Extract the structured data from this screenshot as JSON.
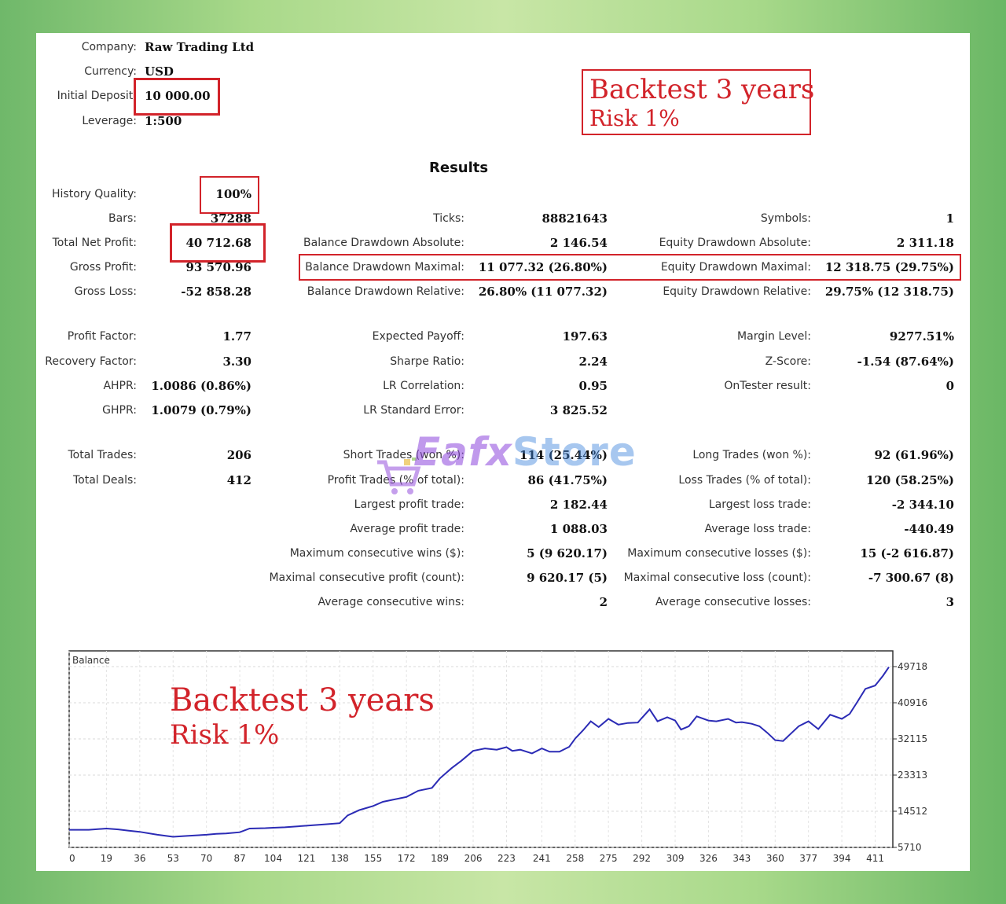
{
  "header": {
    "company_label": "Company:",
    "company_value": "Raw Trading Ltd",
    "currency_label": "Currency:",
    "currency_value": "USD",
    "deposit_label": "Initial Deposit:",
    "deposit_value": "10 000.00",
    "leverage_label": "Leverage:",
    "leverage_value": "1:500"
  },
  "promo_top": {
    "line1": "Backtest 3 years",
    "line2": "Risk 1%"
  },
  "results_title": "Results",
  "col1": [
    {
      "label": "History Quality:",
      "value": "100%"
    },
    {
      "label": "Bars:",
      "value": "37288"
    },
    {
      "label": "Total Net Profit:",
      "value": "40 712.68"
    },
    {
      "label": "Gross Profit:",
      "value": "93 570.96"
    },
    {
      "label": "Gross Loss:",
      "value": "-52 858.28"
    },
    {
      "label": "Profit Factor:",
      "value": "1.77"
    },
    {
      "label": "Recovery Factor:",
      "value": "3.30"
    },
    {
      "label": "AHPR:",
      "value": "1.0086 (0.86%)"
    },
    {
      "label": "GHPR:",
      "value": "1.0079 (0.79%)"
    },
    {
      "label": "Total Trades:",
      "value": "206"
    },
    {
      "label": "Total Deals:",
      "value": "412"
    }
  ],
  "col2": [
    {
      "label": "Ticks:",
      "value": "88821643"
    },
    {
      "label": "Balance Drawdown Absolute:",
      "value": "2 146.54"
    },
    {
      "label": "Balance Drawdown Maximal:",
      "value": "11 077.32 (26.80%)"
    },
    {
      "label": "Balance Drawdown Relative:",
      "value": "26.80% (11 077.32)"
    },
    {
      "label": "Expected Payoff:",
      "value": "197.63"
    },
    {
      "label": "Sharpe Ratio:",
      "value": "2.24"
    },
    {
      "label": "LR Correlation:",
      "value": "0.95"
    },
    {
      "label": "LR Standard Error:",
      "value": "3 825.52"
    },
    {
      "label": "Short Trades (won %):",
      "value": "114 (25.44%)"
    },
    {
      "label": "Profit Trades (% of total):",
      "value": "86 (41.75%)"
    },
    {
      "label": "Largest profit trade:",
      "value": "2 182.44"
    },
    {
      "label": "Average profit trade:",
      "value": "1 088.03"
    },
    {
      "label": "Maximum consecutive wins ($):",
      "value": "5 (9 620.17)"
    },
    {
      "label": "Maximal consecutive profit (count):",
      "value": "9 620.17 (5)"
    },
    {
      "label": "Average consecutive wins:",
      "value": "2"
    }
  ],
  "col3": [
    {
      "label": "Symbols:",
      "value": "1"
    },
    {
      "label": "Equity Drawdown Absolute:",
      "value": "2 311.18"
    },
    {
      "label": "Equity Drawdown Maximal:",
      "value": "12 318.75 (29.75%)"
    },
    {
      "label": "Equity Drawdown Relative:",
      "value": "29.75% (12 318.75)"
    },
    {
      "label": "Margin Level:",
      "value": "9277.51%"
    },
    {
      "label": "Z-Score:",
      "value": "-1.54 (87.64%)"
    },
    {
      "label": "OnTester result:",
      "value": "0"
    },
    {
      "label": "Long Trades (won %):",
      "value": "92 (61.96%)"
    },
    {
      "label": "Loss Trades (% of total):",
      "value": "120 (58.25%)"
    },
    {
      "label": "Largest loss trade:",
      "value": "-2 344.10"
    },
    {
      "label": "Average loss trade:",
      "value": "-440.49"
    },
    {
      "label": "Maximum consecutive losses ($):",
      "value": "15 (-2 616.87)"
    },
    {
      "label": "Maximal consecutive loss (count):",
      "value": "-7 300.67 (8)"
    },
    {
      "label": "Average consecutive losses:",
      "value": "3"
    }
  ],
  "watermark": {
    "part1": "Eafx",
    "part2": "Store"
  },
  "chart_data": {
    "type": "line",
    "title": "Balance",
    "promo_line1": "Backtest 3 years",
    "promo_line2": "Risk 1%",
    "x_ticks": [
      0,
      19,
      36,
      53,
      70,
      87,
      104,
      121,
      138,
      155,
      172,
      189,
      206,
      223,
      241,
      258,
      275,
      292,
      309,
      326,
      343,
      360,
      377,
      394,
      411
    ],
    "y_ticks": [
      5710,
      14512,
      23313,
      32115,
      40916,
      49718
    ],
    "xlim": [
      0,
      420
    ],
    "ylim": [
      5710,
      49718
    ],
    "grid": true,
    "line_color": "#2b2bb5",
    "series": [
      {
        "x": [
          0,
          10,
          19,
          25,
          30,
          36,
          45,
          53,
          60,
          70,
          75,
          80,
          87,
          92,
          100,
          104,
          110,
          121,
          130,
          138,
          142,
          148,
          155,
          160,
          165,
          172,
          178,
          185,
          189,
          195,
          200,
          206,
          212,
          218,
          223,
          226,
          230,
          236,
          241,
          245,
          250,
          255,
          258,
          262,
          266,
          270,
          275,
          280,
          285,
          290,
          292,
          296,
          300,
          305,
          309,
          312,
          316,
          320,
          326,
          330,
          336,
          340,
          343,
          348,
          352,
          356,
          360,
          364,
          368,
          372,
          377,
          382,
          388,
          394,
          398,
          402,
          406,
          411,
          415,
          418
        ],
        "y": [
          10000,
          10000,
          10300,
          10100,
          9800,
          9500,
          8800,
          8300,
          8500,
          8800,
          9000,
          9100,
          9400,
          10300,
          10400,
          10500,
          10600,
          11000,
          11300,
          11600,
          13500,
          14800,
          15800,
          16800,
          17300,
          18000,
          19500,
          20200,
          22500,
          25000,
          26800,
          29200,
          29800,
          29500,
          30100,
          29200,
          29500,
          28600,
          29800,
          29000,
          29000,
          30200,
          32200,
          34200,
          36400,
          35000,
          37000,
          35600,
          36000,
          36100,
          37200,
          39300,
          36400,
          37400,
          36600,
          34400,
          35200,
          37600,
          36600,
          36400,
          37000,
          36100,
          36200,
          35800,
          35200,
          33600,
          31800,
          31600,
          33400,
          35200,
          36400,
          34500,
          38000,
          37000,
          38200,
          41200,
          44300,
          45100,
          47500,
          49600
        ]
      }
    ]
  }
}
